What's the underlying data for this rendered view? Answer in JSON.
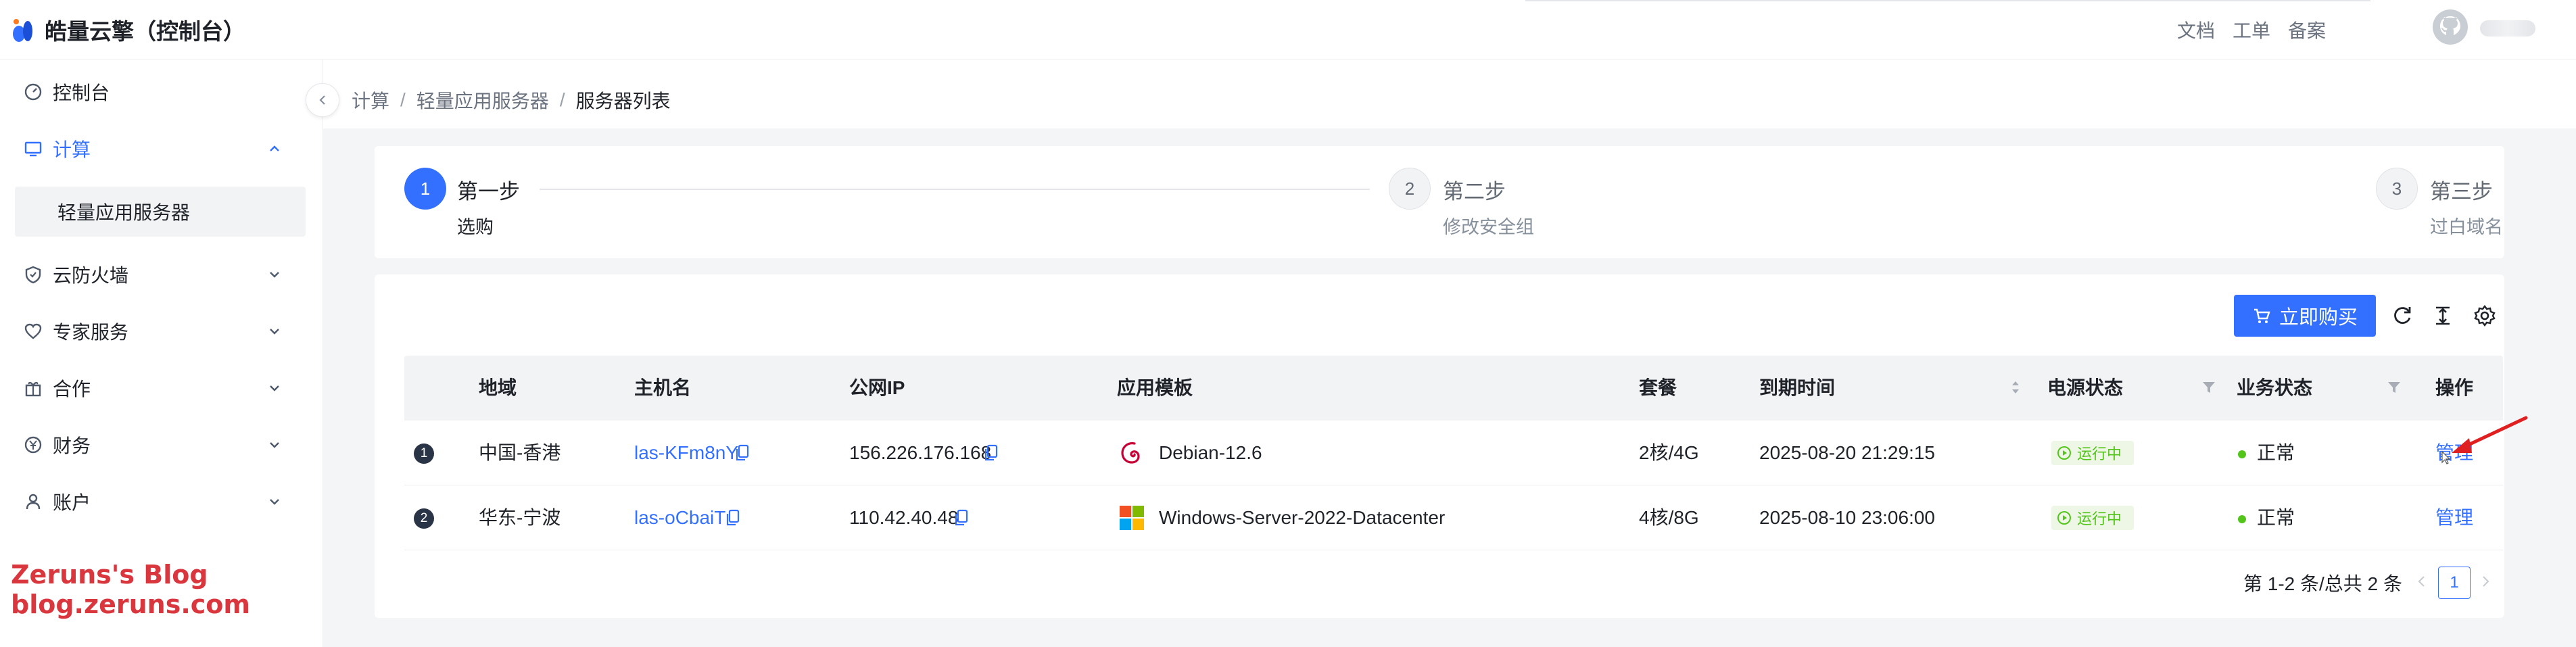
{
  "header": {
    "title": "皓量云擎（控制台）",
    "links": [
      "文档",
      "工单",
      "备案"
    ]
  },
  "sidebar": {
    "items": [
      {
        "label": "控制台",
        "icon": "dashboard-icon"
      },
      {
        "label": "计算",
        "icon": "monitor-icon",
        "expanded": true
      },
      {
        "label": "云防火墙",
        "icon": "shield-icon"
      },
      {
        "label": "专家服务",
        "icon": "heart-icon"
      },
      {
        "label": "合作",
        "icon": "gift-icon"
      },
      {
        "label": "财务",
        "icon": "yen-icon"
      },
      {
        "label": "账户",
        "icon": "user-icon"
      }
    ],
    "sub_item": "轻量应用服务器"
  },
  "watermark": {
    "line1": "Zeruns's Blog",
    "line2": "blog.zeruns.com"
  },
  "breadcrumb": [
    "计算",
    "轻量应用服务器",
    "服务器列表"
  ],
  "steps": [
    {
      "num": "1",
      "title": "第一步",
      "desc": "选购",
      "active": true
    },
    {
      "num": "2",
      "title": "第二步",
      "desc": "修改安全组",
      "active": false
    },
    {
      "num": "3",
      "title": "第三步",
      "desc": "过白域名",
      "active": false
    }
  ],
  "toolbar": {
    "buy_label": "立即购买"
  },
  "table": {
    "columns": [
      "地域",
      "主机名",
      "公网IP",
      "应用模板",
      "套餐",
      "到期时间",
      "电源状态",
      "业务状态",
      "操作"
    ],
    "rows": [
      {
        "index": "1",
        "region": "中国-香港",
        "hostname": "las-KFm8nY",
        "ip": "156.226.176.168",
        "template": "Debian-12.6",
        "template_icon": "debian-icon",
        "plan": "2核/4G",
        "expire": "2025-08-20 21:29:15",
        "power": "运行中",
        "business": "正常",
        "action": "管理"
      },
      {
        "index": "2",
        "region": "华东-宁波",
        "hostname": "las-oCbaiT",
        "ip": "110.42.40.48",
        "template": "Windows-Server-2022-Datacenter",
        "template_icon": "windows-icon",
        "plan": "4核/8G",
        "expire": "2025-08-10 23:06:00",
        "power": "运行中",
        "business": "正常",
        "action": "管理"
      }
    ]
  },
  "pagination": {
    "info": "第 1-2 条/总共 2 条",
    "current": "1"
  },
  "colors": {
    "accent": "#3370ff",
    "success": "#52c41a",
    "annotation": "#e02020"
  }
}
